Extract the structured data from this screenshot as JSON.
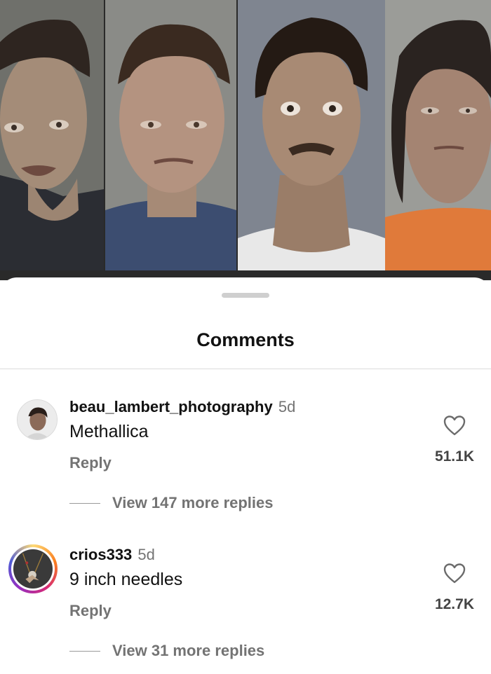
{
  "post_image": {
    "alt": "Four side-by-side portrait photos"
  },
  "sheet": {
    "title": "Comments"
  },
  "comments": [
    {
      "username": "beau_lambert_photography",
      "time": "5d",
      "text": "Methallica",
      "reply_label": "Reply",
      "likes": "51.1K",
      "view_replies": "View 147 more replies",
      "avatar_icon": "profile-photo-avatar",
      "has_story_ring": false
    },
    {
      "username": "crios333",
      "time": "5d",
      "text": "9 inch needles",
      "reply_label": "Reply",
      "likes": "12.7K",
      "view_replies": "View 31 more replies",
      "avatar_icon": "profile-photo-avatar",
      "has_story_ring": true
    }
  ],
  "icons": {
    "like": "heart-outline-icon"
  },
  "colors": {
    "text_primary": "#111111",
    "text_secondary": "#737373",
    "divider": "#dbdbdb",
    "story_ring": [
      "#feda75",
      "#fa7e1e",
      "#d62976",
      "#962fbf",
      "#4f5bd5"
    ]
  }
}
